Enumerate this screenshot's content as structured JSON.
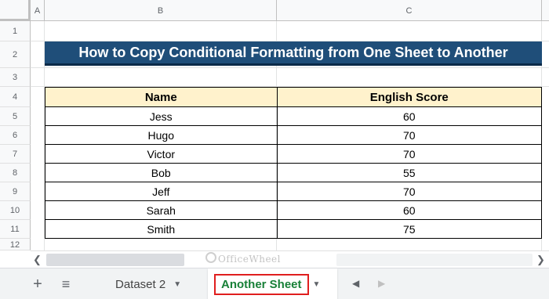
{
  "columns": [
    "A",
    "B",
    "C"
  ],
  "rows": [
    "1",
    "2",
    "3",
    "4",
    "5",
    "6",
    "7",
    "8",
    "9",
    "10",
    "11",
    "12"
  ],
  "title": "How to Copy Conditional Formatting from One Sheet to Another",
  "table": {
    "headers": [
      "Name",
      "English Score"
    ],
    "rows": [
      [
        "Jess",
        "60"
      ],
      [
        "Hugo",
        "70"
      ],
      [
        "Victor",
        "70"
      ],
      [
        "Bob",
        "55"
      ],
      [
        "Jeff",
        "70"
      ],
      [
        "Sarah",
        "60"
      ],
      [
        "Smith",
        "75"
      ]
    ]
  },
  "watermark": "OfficeWheel",
  "tabs": [
    {
      "label": "Dataset 2",
      "active": false
    },
    {
      "label": "Another Sheet",
      "active": true,
      "color": "#188038",
      "highlight": "#e01e1e"
    }
  ],
  "icons": {
    "add_sheet": "plus-icon",
    "all_sheets": "menu-icon",
    "scroll_left": "chevron-left-icon",
    "scroll_right": "chevron-right-icon"
  },
  "colors": {
    "title_bg": "#1f4e79",
    "header_bg": "#fff2cc"
  }
}
